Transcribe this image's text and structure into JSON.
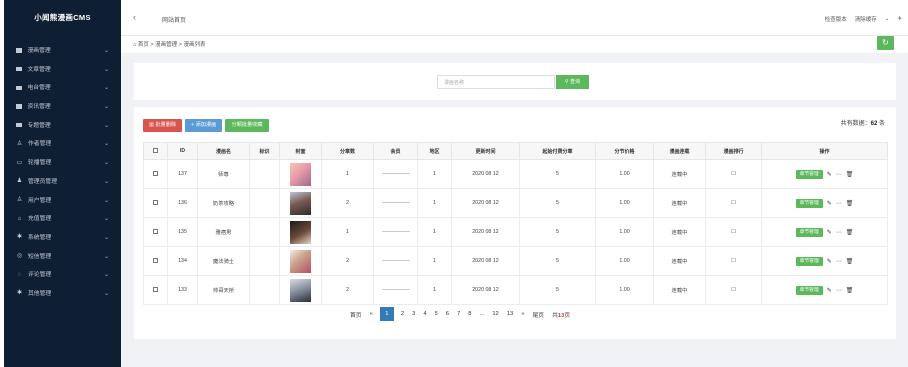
{
  "app": {
    "brand": "小闻熊漫画CMS"
  },
  "sidebar": {
    "items": [
      {
        "label": "漫画管理",
        "icon": "square-icon"
      },
      {
        "label": "文章管理",
        "icon": "square-icon"
      },
      {
        "label": "电台管理",
        "icon": "square-icon"
      },
      {
        "label": "资讯管理",
        "icon": "square-icon"
      },
      {
        "label": "专题管理",
        "icon": "square-icon"
      },
      {
        "label": "作者管理",
        "icon": "user-icon"
      },
      {
        "label": "轮播管理",
        "icon": "image-icon"
      },
      {
        "label": "管理员管理",
        "icon": "admin-icon"
      },
      {
        "label": "用户管理",
        "icon": "user-icon"
      },
      {
        "label": "充值管理",
        "icon": "lock-icon"
      },
      {
        "label": "系统管理",
        "icon": "gear-icon"
      },
      {
        "label": "短信管理",
        "icon": "message-icon"
      },
      {
        "label": "评论管理",
        "icon": "comment-icon"
      },
      {
        "label": "其他管理",
        "icon": "gear-icon"
      }
    ]
  },
  "topbar": {
    "title": "网站首页",
    "check_version": "检查版本",
    "clear_cache": "清除缓存"
  },
  "breadcrumb": {
    "home": "首页",
    "sep": ">",
    "section": "漫画管理",
    "page": "漫画列表"
  },
  "search": {
    "placeholder": "漫画名称",
    "button": "查询"
  },
  "toolbar": {
    "batch_delete": "批量删除",
    "add_comic": "添加漫画",
    "batch_collect": "分類批量收藏",
    "total_label": "共有数据：",
    "total_value": "62",
    "total_unit": "条"
  },
  "table": {
    "headers": [
      "",
      "ID",
      "漫画名",
      "标识",
      "封面",
      "分章数",
      "会员",
      "地区",
      "更新时间",
      "起始付费分章",
      "分节价格",
      "漫画连载",
      "漫画排行",
      "操作"
    ],
    "rows": [
      {
        "id": "137",
        "name": "师尊",
        "chapters": "1",
        "region": "1",
        "updated": "2020 08 12",
        "pay_start": "5",
        "price": "1.00",
        "serial": "连载中",
        "rank": "☐",
        "op": "章节管理"
      },
      {
        "id": "136",
        "name": "奶茶攻略",
        "chapters": "2",
        "region": "1",
        "updated": "2020 08 12",
        "pay_start": "5",
        "price": "1.00",
        "serial": "连载中",
        "rank": "☐",
        "op": "章节管理"
      },
      {
        "id": "135",
        "name": "雅痞男",
        "chapters": "1",
        "region": "1",
        "updated": "2020 08 12",
        "pay_start": "5",
        "price": "1.00",
        "serial": "连载中",
        "rank": "☐",
        "op": "章节管理"
      },
      {
        "id": "134",
        "name": "魔法骑士",
        "chapters": "2",
        "region": "1",
        "updated": "2020 08 12",
        "pay_start": "5",
        "price": "1.00",
        "serial": "连载中",
        "rank": "☐",
        "op": "章节管理"
      },
      {
        "id": "133",
        "name": "帅哥天桥",
        "chapters": "2",
        "region": "1",
        "updated": "2020 08 12",
        "pay_start": "5",
        "price": "1.00",
        "serial": "连载中",
        "rank": "☐",
        "op": "章节管理"
      }
    ]
  },
  "pagination": {
    "first": "首页",
    "prev": "«",
    "pages": [
      "1",
      "2",
      "3",
      "4",
      "5",
      "6",
      "7",
      "8",
      "...",
      "12",
      "13"
    ],
    "current": "1",
    "next": "»",
    "last": "尾页",
    "total_prefix": "共",
    "total_pages": "13",
    "total_suffix": "页"
  },
  "colors": {
    "sidebar_bg": "#0f1f33",
    "primary": "#337ab7",
    "success": "#5cb85c",
    "danger": "#d9534f",
    "info": "#5b9bd5"
  }
}
